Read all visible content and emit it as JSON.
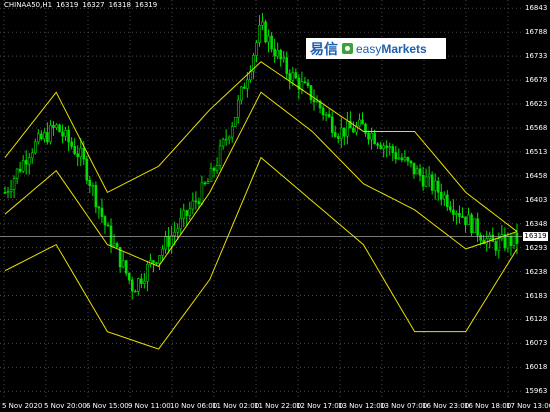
{
  "header": {
    "symbol": "CHINAA50,H1",
    "open": "16319",
    "high": "16327",
    "low": "16318",
    "close": "16319"
  },
  "logo": {
    "cn_text": "易信",
    "brand_easy": "easy",
    "brand_markets": "Markets"
  },
  "current_price": "16319",
  "y_axis": [
    "16843",
    "16788",
    "16733",
    "16678",
    "16623",
    "16568",
    "16513",
    "16458",
    "16403",
    "16348",
    "16293",
    "16238",
    "16183",
    "16128",
    "16073",
    "16018",
    "15963"
  ],
  "x_axis": [
    "5 Nov 2020",
    "5 Nov 20:00",
    "6 Nov 15:00",
    "9 Nov 11:00",
    "10 Nov 06:00",
    "11 Nov 02:00",
    "11 Nov 22:00",
    "12 Nov 17:00",
    "13 Nov 12:00",
    "13 Nov 07:00",
    "16 Nov 23:00",
    "16 Nov 18:00",
    "17 Nov 13:00"
  ],
  "colors": {
    "bullish": "#00e000",
    "bearish": "#00e000",
    "band": "#e8e000",
    "grid": "#4a4a4a",
    "current_line": "#c0c0c0"
  },
  "chart_data": {
    "type": "line",
    "title": "",
    "ylim": [
      15943,
      16862
    ],
    "series": [
      {
        "name": "CHINAA50,H1",
        "x": [
          0,
          5,
          10,
          15,
          20,
          25,
          30,
          35,
          40,
          45,
          50,
          55,
          60,
          65,
          70,
          75,
          80,
          85,
          90,
          95,
          100
        ],
        "y": [
          16420,
          16520,
          16570,
          16500,
          16330,
          16200,
          16280,
          16360,
          16450,
          16600,
          16800,
          16700,
          16640,
          16560,
          16570,
          16520,
          16470,
          16420,
          16360,
          16300,
          16310
        ]
      },
      {
        "name": "upper-band",
        "x": [
          0,
          10,
          20,
          30,
          40,
          50,
          60,
          70,
          80,
          90,
          100
        ],
        "y": [
          16500,
          16650,
          16420,
          16480,
          16610,
          16720,
          16640,
          16560,
          16560,
          16420,
          16330
        ]
      },
      {
        "name": "middle-band",
        "x": [
          0,
          10,
          20,
          30,
          40,
          50,
          60,
          70,
          80,
          90,
          100
        ],
        "y": [
          16370,
          16470,
          16300,
          16250,
          16420,
          16650,
          16560,
          16440,
          16380,
          16290,
          16330
        ]
      },
      {
        "name": "lower-band",
        "x": [
          0,
          10,
          20,
          30,
          40,
          50,
          60,
          70,
          80,
          90,
          100
        ],
        "y": [
          16240,
          16300,
          16100,
          16060,
          16220,
          16500,
          16400,
          16300,
          16100,
          16100,
          16290
        ]
      }
    ]
  }
}
